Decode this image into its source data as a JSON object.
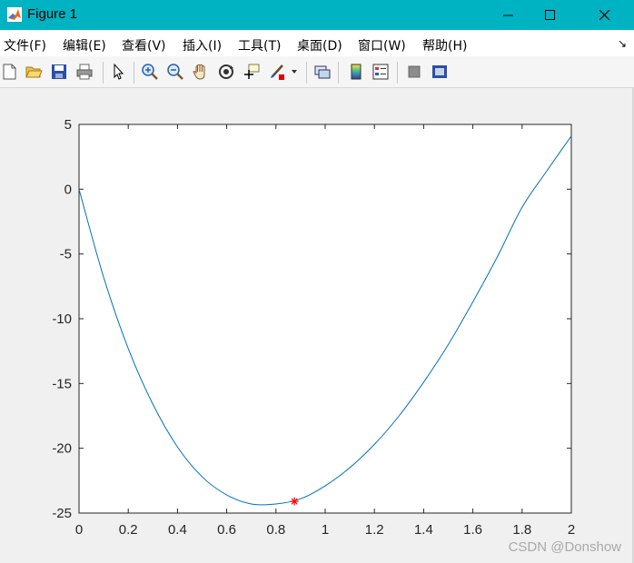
{
  "window": {
    "title": "Figure 1",
    "controls": {
      "minimize": "minimize",
      "maximize": "maximize",
      "close": "close"
    }
  },
  "menu": {
    "items": [
      "文件(F)",
      "编辑(E)",
      "查看(V)",
      "插入(I)",
      "工具(T)",
      "桌面(D)",
      "窗口(W)",
      "帮助(H)"
    ]
  },
  "toolbar": {
    "icons": [
      "new-figure-icon",
      "open-file-icon",
      "save-icon",
      "print-icon",
      "pointer-icon",
      "zoom-in-icon",
      "zoom-out-icon",
      "pan-hand-icon",
      "rotate-3d-icon",
      "data-cursor-icon",
      "brush-icon",
      "link-plot-icon",
      "colorbar-icon",
      "legend-icon",
      "hide-plot-tools-icon",
      "show-plot-tools-icon"
    ]
  },
  "colors": {
    "titlebar": "#00b3c2",
    "line": "#0072bd",
    "marker": "#ff0000"
  },
  "watermark": "CSDN @Donshow",
  "chart_data": {
    "type": "line",
    "x_ticks": [
      "0",
      "0.2",
      "0.4",
      "0.6",
      "0.8",
      "1",
      "1.2",
      "1.4",
      "1.6",
      "1.8",
      "2"
    ],
    "y_ticks": [
      "5",
      "0",
      "-5",
      "-10",
      "-15",
      "-20",
      "-25"
    ],
    "xlim": [
      0,
      2
    ],
    "ylim": [
      -25,
      5
    ],
    "grid": false,
    "series": [
      {
        "x": [
          0,
          0.1,
          0.2,
          0.3,
          0.4,
          0.5,
          0.6,
          0.7,
          0.8,
          0.9,
          1.0,
          1.1,
          1.2,
          1.3,
          1.4,
          1.5,
          1.6,
          1.7,
          1.8,
          1.9,
          2.0
        ],
        "y": [
          0,
          -6.8,
          -12.3,
          -16.6,
          -19.9,
          -22.2,
          -23.6,
          -24.3,
          -24.3,
          -23.9,
          -22.9,
          -21.5,
          -19.7,
          -17.5,
          -14.9,
          -12.0,
          -8.7,
          -5.2,
          -1.4,
          1.4,
          4.1
        ]
      }
    ],
    "marker": {
      "x": 0.875,
      "y": -24.1,
      "symbol": "*"
    }
  }
}
